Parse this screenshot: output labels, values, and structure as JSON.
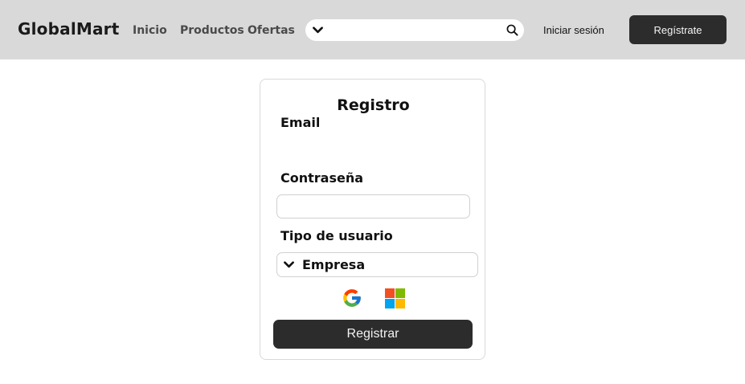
{
  "header": {
    "brand": "GlobalMart",
    "nav": [
      "Inicio",
      "Productos",
      "Ofertas"
    ],
    "search": {
      "value": "",
      "placeholder": ""
    },
    "login_label": "Iniciar sesión",
    "signup_label": "Regístrate"
  },
  "form": {
    "title": "Registro",
    "email_label": "Email",
    "password_label": "Contraseña",
    "user_type_label": "Tipo de usuario",
    "user_type_value": "Empresa",
    "submit_label": "Registrar"
  },
  "icons": {
    "search_dropdown": "chevron-down-icon",
    "search": "search-icon",
    "select_dropdown": "chevron-down-icon",
    "google": "google-icon",
    "microsoft": "microsoft-icon"
  },
  "colors": {
    "header_bg": "#d9d9d9",
    "button_bg": "#2c2c2c",
    "button_text": "#f5f5f5"
  }
}
